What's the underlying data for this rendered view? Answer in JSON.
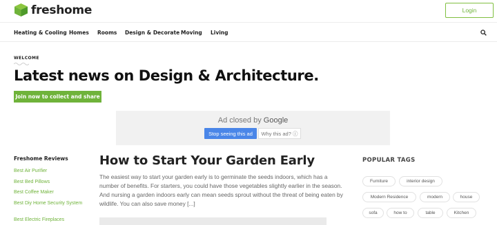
{
  "brand": {
    "name": "freshome",
    "accent": "#6fb33a"
  },
  "header": {
    "login_label": "Login"
  },
  "nav": {
    "items": [
      "Heating & Cooling",
      "Homes",
      "Rooms",
      "Design & Decorate",
      "Moving",
      "Living"
    ],
    "search_icon": "search-icon"
  },
  "hero": {
    "eyebrow": "WELCOME",
    "headline": "Latest news on Design & Architecture.",
    "cta_label": "Join now to collect and share"
  },
  "ad": {
    "closed_text": "Ad closed by",
    "closed_brand": "Google",
    "stop_label": "Stop seeing this ad",
    "why_label": "Why this ad? ⓘ"
  },
  "sidebar": {
    "title": "Freshome Reviews",
    "links": [
      "Best Air Purifier",
      "Best Bed Pillows",
      "Best Coffee Maker",
      "Best Diy Home Security System",
      "Best Electric Fireplaces"
    ]
  },
  "article": {
    "title": "How to Start Your Garden Early",
    "excerpt": "The easiest way to start your garden early is to germinate the seeds indoors, which has a number of benefits. For starters, you could have those vegetables slightly earlier in the season. And nursing a garden indoors early can mean seeds sprout without the threat of being eaten by wildlife. You can also save money [...]"
  },
  "tags": {
    "title": "POPULAR TAGS",
    "items": [
      "Furniture",
      "interior design",
      "Modern Residence",
      "modern",
      "house",
      "sofa",
      "how to",
      "table",
      "Kitchen"
    ]
  }
}
